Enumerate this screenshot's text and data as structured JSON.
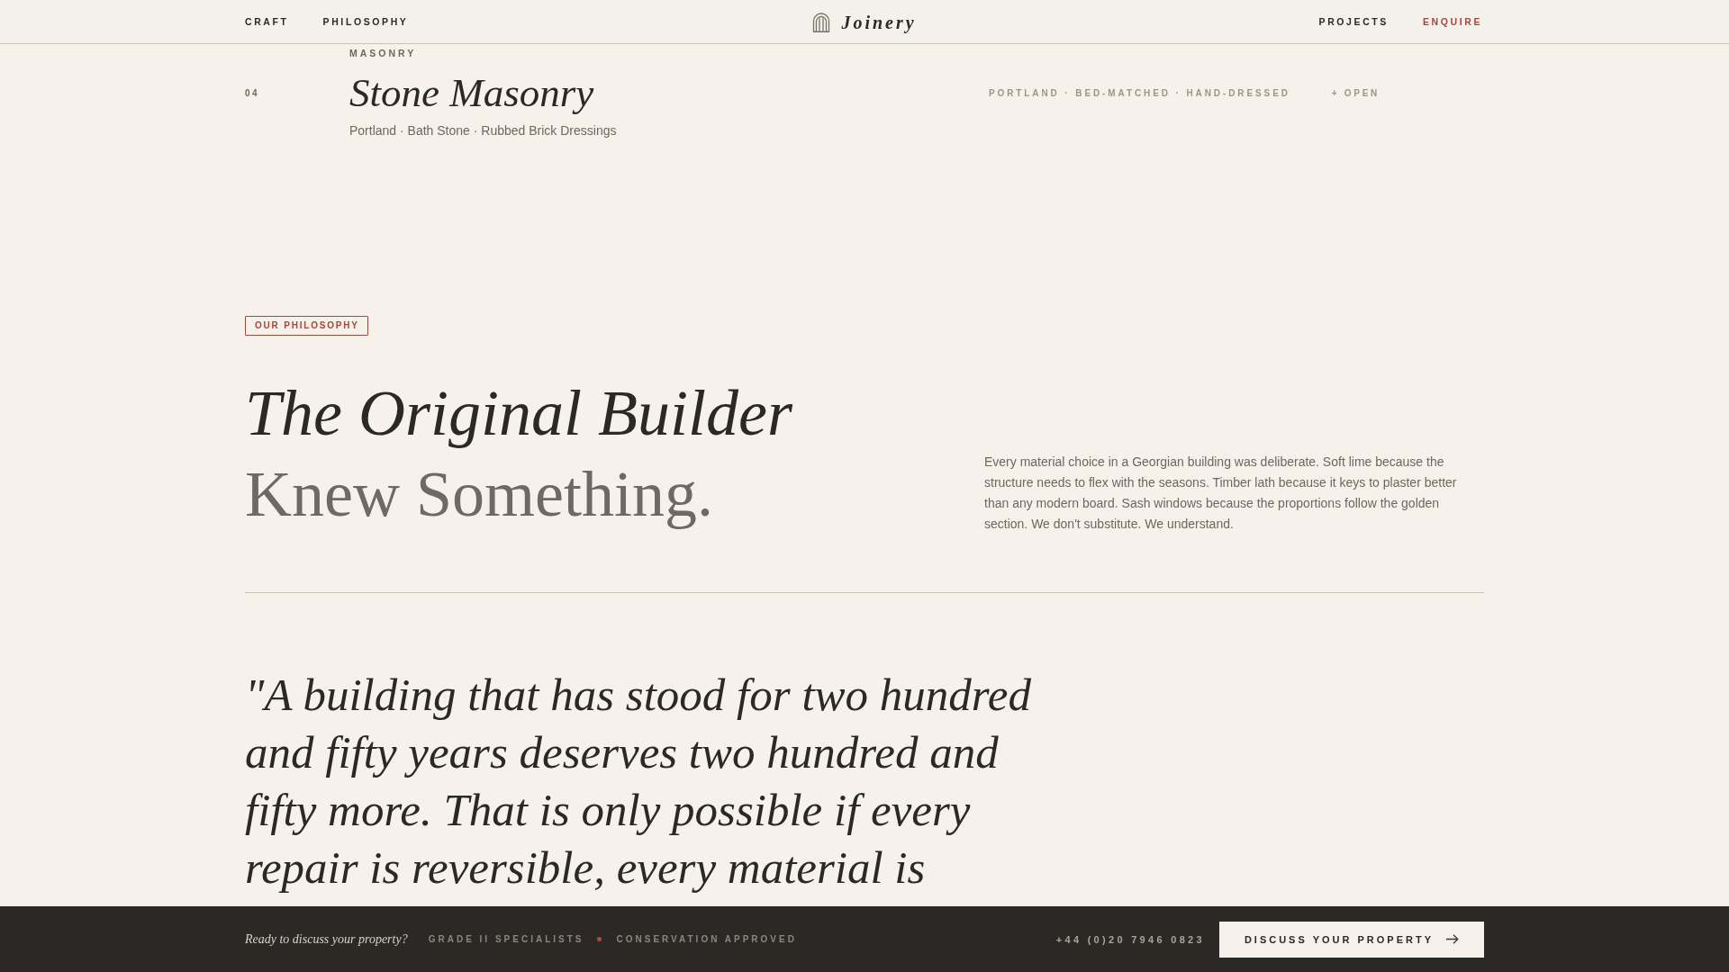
{
  "nav": {
    "links_left": [
      {
        "label": "CRAFT",
        "kind": "link"
      },
      {
        "label": "PHILOSOPHY",
        "kind": "link"
      }
    ],
    "logo": {
      "name": "Joinery"
    },
    "links_right": [
      {
        "label": "PROJECTS",
        "kind": "link"
      },
      {
        "label": "ENQUIRE",
        "kind": "accent"
      }
    ]
  },
  "service": {
    "number": "04",
    "category": "MASONRY",
    "title": "Stone Masonry",
    "materials": "Portland · Bath Stone · Rubbed Brick Dressings",
    "tags": "PORTLAND · BED-MATCHED · HAND-DRESSED",
    "toggle": "+ OPEN"
  },
  "philosophy": {
    "badge": "OUR PHILOSOPHY",
    "headline": {
      "line_1": "The Original Builder",
      "line_2": "Knew Something."
    },
    "body": "Every material choice in a Georgian building was deliberate. Soft lime because the structure needs to flex with the seasons. Timber lath because it keys to plaster better than any modern board. Sash windows because the proportions follow the golden section. We don't substitute. We understand.",
    "quote": "\"A building that has stood for two hundred and fifty years deserves two hundred and fifty more. That is only possible if every repair is reversible, every material is"
  },
  "footer": {
    "prompt": "Ready to discuss your property?",
    "credentials": [
      "GRADE II SPECIALISTS",
      "CONSERVATION APPROVED"
    ],
    "phone": "+44 (0)20 7946 0823",
    "button": "DISCUSS YOUR PROPERTY"
  }
}
